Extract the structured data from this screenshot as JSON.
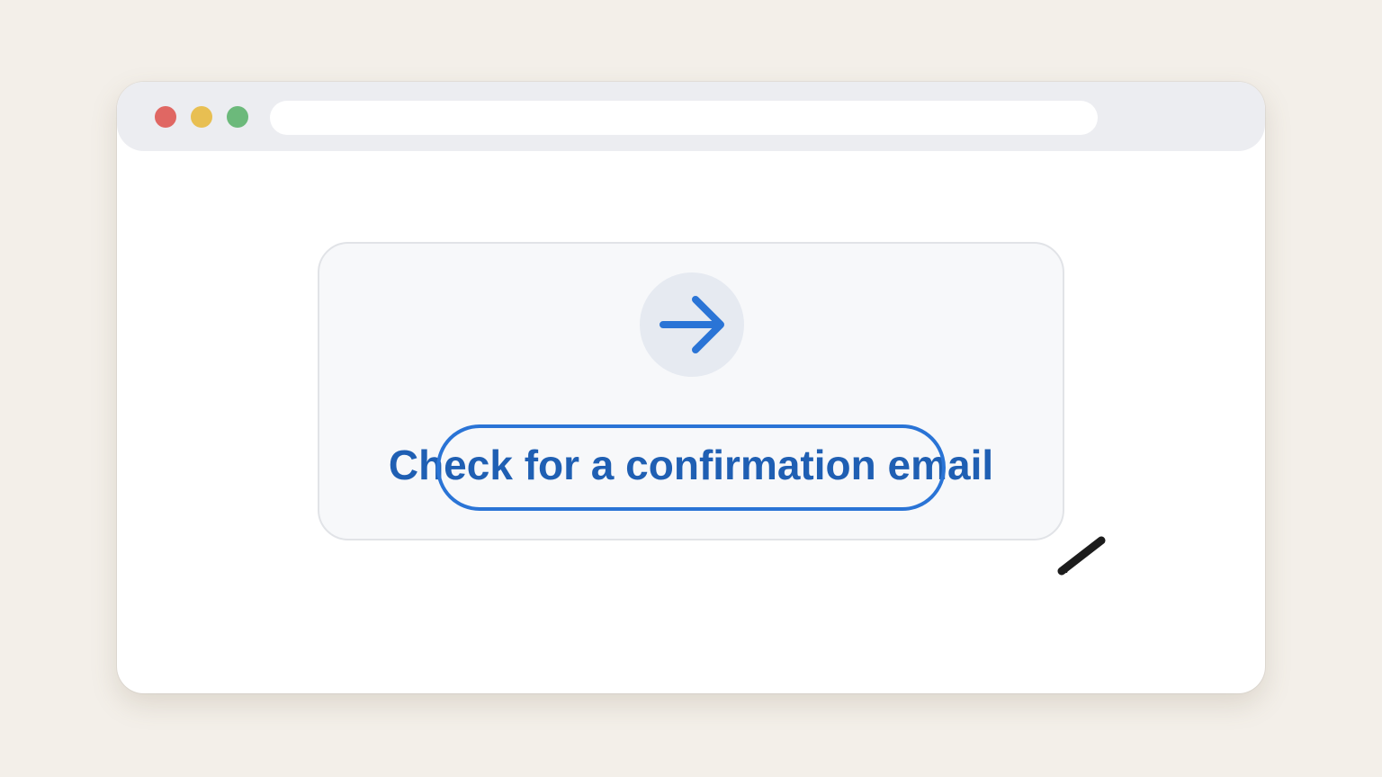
{
  "window": {
    "dots": [
      {
        "name": "close",
        "color": "#e06763"
      },
      {
        "name": "minimize",
        "color": "#e8bf52"
      },
      {
        "name": "maximize",
        "color": "#6cb97b"
      }
    ],
    "address_bar": {
      "value": "",
      "placeholder": ""
    }
  },
  "card": {
    "icon": "arrow-right-icon",
    "headline": "Check for a confirmation email",
    "headline_color": "#1f5fb3",
    "accent_color": "#2a74d6"
  },
  "annotation": {
    "highlight_color": "#2a74d6",
    "pointer_icon": "pen-pointer-icon"
  }
}
